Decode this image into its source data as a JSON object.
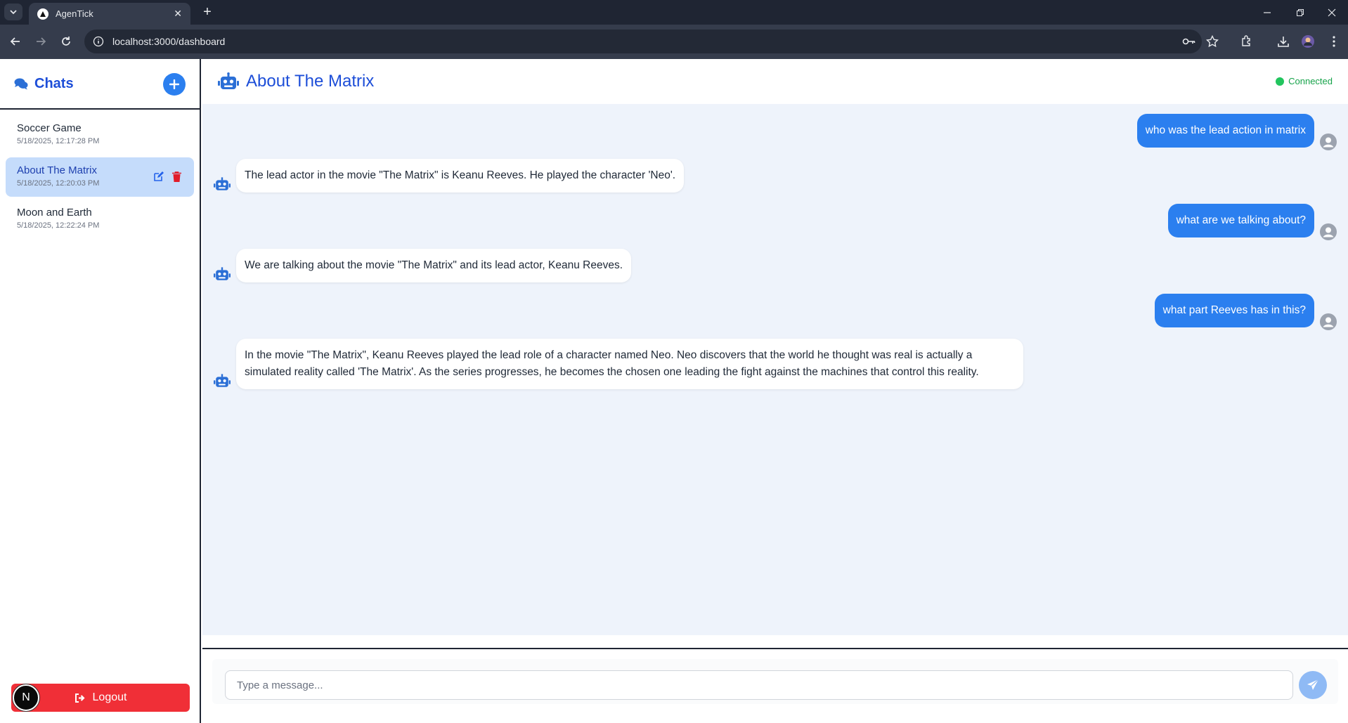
{
  "browser": {
    "tab_title": "AgenTick",
    "url": "localhost:3000/dashboard"
  },
  "sidebar": {
    "title": "Chats",
    "chats": [
      {
        "name": "Soccer Game",
        "time": "5/18/2025, 12:17:28 PM",
        "active": false
      },
      {
        "name": "About The Matrix",
        "time": "5/18/2025, 12:20:03 PM",
        "active": true
      },
      {
        "name": "Moon and Earth",
        "time": "5/18/2025, 12:22:24 PM",
        "active": false
      }
    ],
    "logout_label": "Logout",
    "badge_letter": "N"
  },
  "chat": {
    "title": "About The Matrix",
    "status": "Connected",
    "messages": [
      {
        "role": "user",
        "text": "who was the lead action in matrix"
      },
      {
        "role": "bot",
        "text": "The lead actor in the movie \"The Matrix\" is Keanu Reeves. He played the character 'Neo'."
      },
      {
        "role": "user",
        "text": "what are we talking about?"
      },
      {
        "role": "bot",
        "text": "We are talking about the movie \"The Matrix\" and its lead actor, Keanu Reeves."
      },
      {
        "role": "user",
        "text": "what part Reeves has in this?"
      },
      {
        "role": "bot",
        "text": "In the movie \"The Matrix\", Keanu Reeves played the lead role of a character named Neo. Neo discovers that the world he thought was real is actually a simulated reality called 'The Matrix'. As the series progresses, he becomes the chosen one leading the fight against the machines that control this reality."
      }
    ],
    "input_placeholder": "Type a message..."
  },
  "colors": {
    "accent": "#2b7fef",
    "title_blue": "#1d4ed8",
    "logout_red": "#f02f37",
    "status_green": "#22c55e"
  },
  "icons": [
    "chats-icon",
    "plus-icon",
    "edit-icon",
    "trash-icon",
    "robot-icon",
    "user-avatar-icon",
    "send-icon",
    "logout-icon"
  ]
}
